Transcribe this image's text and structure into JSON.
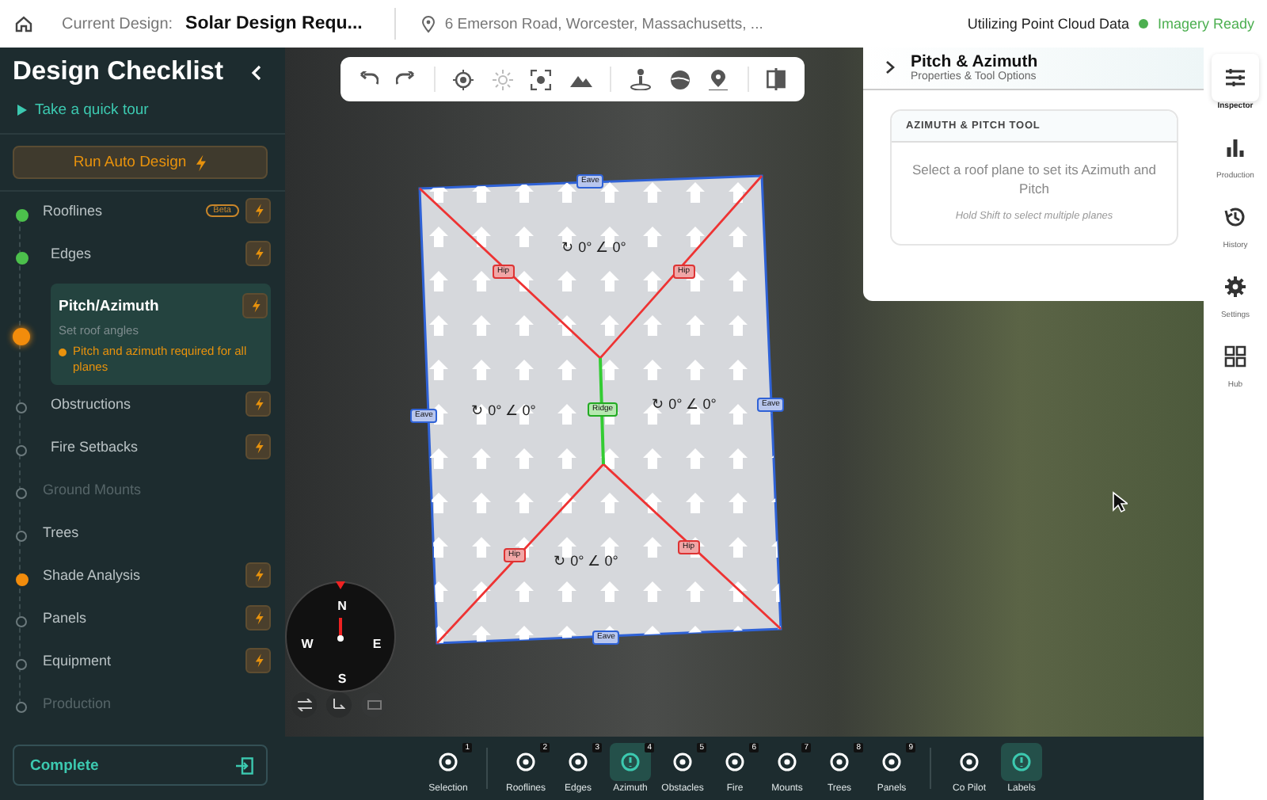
{
  "header": {
    "design_label": "Current Design:",
    "design_name": "Solar Design Requ...",
    "address": "6 Emerson Road, Worcester, Massachusetts, ...",
    "data_source": "Utilizing Point Cloud Data",
    "imagery_status": "Imagery Ready"
  },
  "checklist": {
    "title": "Design Checklist",
    "tour_link": "Take a quick tour",
    "auto_button": "Run Auto Design",
    "complete_button": "Complete",
    "items": [
      {
        "label": "Rooflines",
        "kind": "done",
        "selected": false,
        "badge": "Beta",
        "auto": true,
        "children": [
          {
            "label": "Edges",
            "kind": "done",
            "selected": false,
            "auto": true
          },
          {
            "label": "Pitch/Azimuth",
            "kind": "current",
            "selected": true,
            "subtitle": "Set roof angles",
            "warning": "Pitch and azimuth required for all planes",
            "auto": true
          },
          {
            "label": "Obstructions",
            "kind": "pending",
            "selected": false,
            "auto": true
          },
          {
            "label": "Fire Setbacks",
            "kind": "pending",
            "selected": false,
            "auto": true
          }
        ]
      },
      {
        "label": "Ground Mounts",
        "kind": "locked",
        "selected": false,
        "auto": false
      },
      {
        "label": "Trees",
        "kind": "pending",
        "selected": false,
        "auto": false
      },
      {
        "label": "Shade Analysis",
        "kind": "alert",
        "selected": false,
        "auto": true
      },
      {
        "label": "Panels",
        "kind": "pending",
        "selected": false,
        "auto": true
      },
      {
        "label": "Equipment",
        "kind": "pending",
        "selected": false,
        "auto": true
      },
      {
        "label": "Production",
        "kind": "locked",
        "selected": false,
        "auto": false
      }
    ]
  },
  "map": {
    "planes": [
      {
        "label": "↻ 0° ∠ 0°"
      },
      {
        "label": "↻ 0° ∠ 0°"
      },
      {
        "label": "↻ 0° ∠ 0°"
      },
      {
        "label": "↻ 0° ∠ 0°"
      }
    ],
    "edges": [
      {
        "label": "Eave",
        "kind": "eave"
      },
      {
        "label": "Eave",
        "kind": "eave"
      },
      {
        "label": "Eave",
        "kind": "eave"
      },
      {
        "label": "Eave",
        "kind": "eave"
      },
      {
        "label": "Ridge",
        "kind": "ridge"
      },
      {
        "label": "Hip",
        "kind": "hip"
      },
      {
        "label": "Hip",
        "kind": "hip"
      },
      {
        "label": "Hip",
        "kind": "hip"
      },
      {
        "label": "Hip",
        "kind": "hip"
      }
    ],
    "compass": [
      "N",
      "E",
      "S",
      "W"
    ]
  },
  "inspector": {
    "title": "Pitch & Azimuth",
    "subtitle": "Properties & Tool Options",
    "card_title": "AZIMUTH & PITCH TOOL",
    "message": "Select a roof plane to set its Azimuth and Pitch",
    "hint": "Hold Shift to select multiple planes"
  },
  "rail": [
    {
      "label": "Inspector",
      "selected": true
    },
    {
      "label": "Production",
      "selected": false
    },
    {
      "label": "History",
      "selected": false
    },
    {
      "label": "Settings",
      "selected": false
    },
    {
      "label": "Hub",
      "selected": false
    }
  ],
  "tool_groups": [
    {
      "tools": [
        {
          "label": "Selection",
          "key": "1",
          "selected": false
        }
      ]
    },
    {
      "tools": [
        {
          "label": "Rooflines",
          "key": "2",
          "selected": false
        },
        {
          "label": "Edges",
          "key": "3",
          "selected": false
        },
        {
          "label": "Azimuth",
          "key": "4",
          "selected": true
        },
        {
          "label": "Obstacles",
          "key": "5",
          "selected": false
        },
        {
          "label": "Fire",
          "key": "6",
          "selected": false
        },
        {
          "label": "Mounts",
          "key": "7",
          "selected": false
        },
        {
          "label": "Trees",
          "key": "8",
          "selected": false
        },
        {
          "label": "Panels",
          "key": "9",
          "selected": false
        }
      ]
    },
    {
      "tools": [
        {
          "label": "Co Pilot",
          "selected": false
        },
        {
          "label": "Labels",
          "selected": true
        }
      ]
    }
  ]
}
